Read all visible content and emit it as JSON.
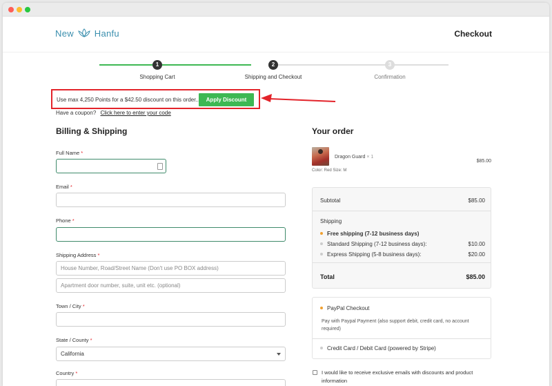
{
  "header": {
    "logo_left": "New",
    "logo_right": "Hanfu",
    "title": "Checkout"
  },
  "steps": [
    {
      "num": "1",
      "label": "Shopping Cart"
    },
    {
      "num": "2",
      "label": "Shipping and Checkout"
    },
    {
      "num": "3",
      "label": "Confirmation"
    }
  ],
  "discount": {
    "text": "Use max 4,250 Points for a $42.50 discount on this order...",
    "button": "Apply Discount"
  },
  "coupon": {
    "prompt": "Have a coupon?",
    "link": "Click here to enter your code"
  },
  "billing": {
    "title": "Billing & Shipping",
    "full_name_label": "Full Name",
    "email_label": "Email",
    "phone_label": "Phone",
    "address_label": "Shipping Address",
    "address1_placeholder": "House Number, Road/Street Name (Don't use PO BOX address)",
    "address2_placeholder": "Apartment door number, suite, unit etc. (optional)",
    "city_label": "Town / City",
    "state_label": "State / County",
    "state_value": "California",
    "country_label": "Country",
    "required_mark": "*"
  },
  "order": {
    "title": "Your order",
    "product_name": "Dragon Guard",
    "product_qty": "× 1",
    "product_price": "$85.00",
    "product_meta": "Color: Red   Size: M",
    "subtotal_label": "Subtotal",
    "subtotal_value": "$85.00",
    "shipping_label": "Shipping",
    "shipping_options": [
      {
        "label": "Free shipping (7-12 business days)",
        "price": "",
        "selected": true
      },
      {
        "label": "Standard Shipping (7-12 business days):",
        "price": "$10.00",
        "selected": false
      },
      {
        "label": "Express Shipping (5-8 business days):",
        "price": "$20.00",
        "selected": false
      }
    ],
    "total_label": "Total",
    "total_value": "$85.00"
  },
  "payment": {
    "paypal_label": "PayPal Checkout",
    "paypal_desc": "Pay with Paypal Payment (also support debit, credit card, no account required)",
    "stripe_label": "Credit Card / Debit Card (powered by Stripe)"
  },
  "optin": {
    "text": "I would like to receive exclusive emails with discounts and product information"
  },
  "colors": {
    "accent_green": "#3db853",
    "highlight_red": "#e3232a",
    "step_active": "#333333",
    "step_line_green": "#3db853"
  }
}
